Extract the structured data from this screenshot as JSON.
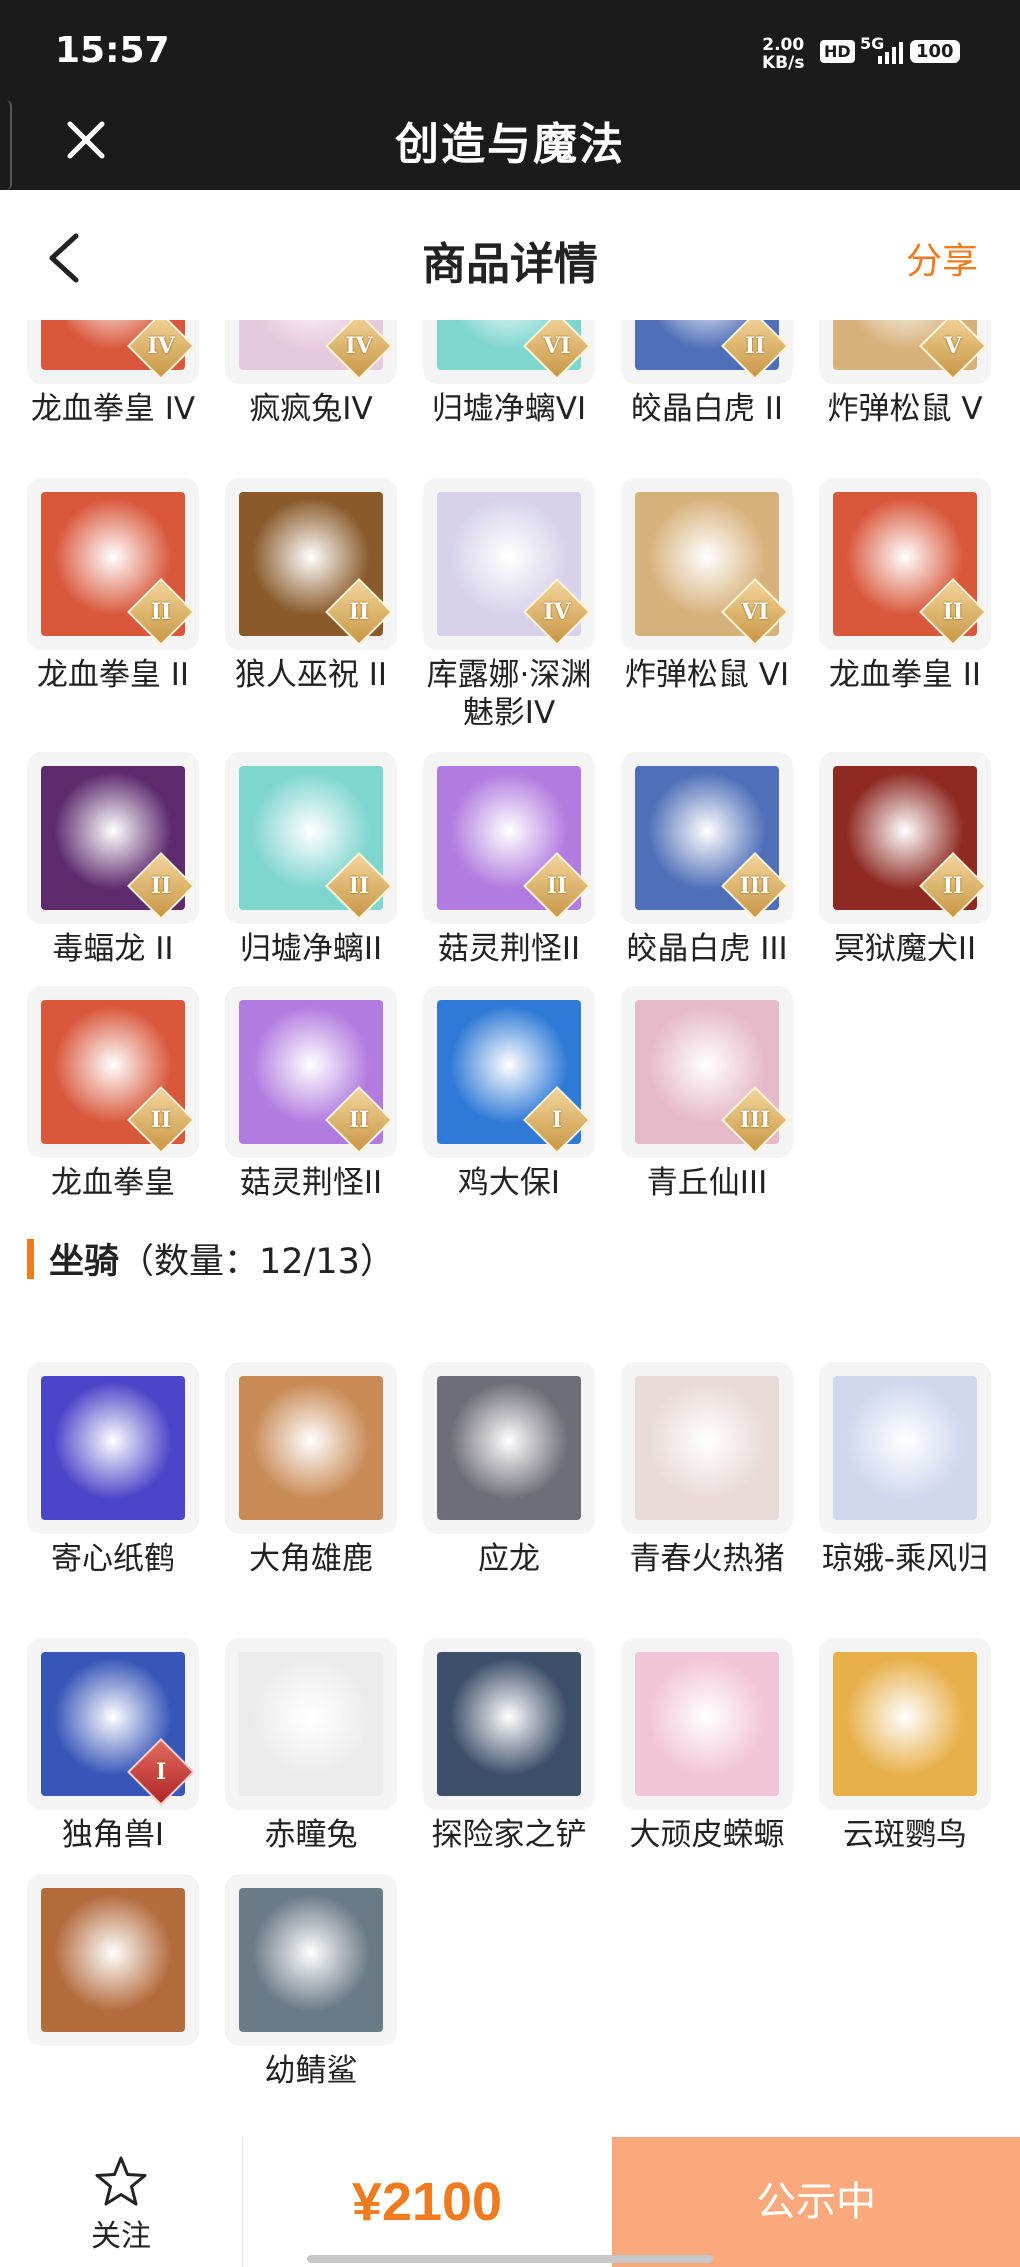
{
  "status_bar": {
    "time": "15:57",
    "net_speed": "2.00",
    "net_unit": "KB/s",
    "hd": "HD",
    "signal": "5G",
    "battery": "100"
  },
  "app": {
    "title": "创造与魔法"
  },
  "page": {
    "title": "商品详情",
    "share": "分享"
  },
  "pets": [
    {
      "name": "龙血拳皇 IV",
      "badge": "IV",
      "icon": "dragon-boxer-icon",
      "color": "#d9573a"
    },
    {
      "name": "疯疯兔IV",
      "badge": "IV",
      "icon": "crazy-rabbit-icon",
      "color": "#e7c9dd"
    },
    {
      "name": "归墟净螭VI",
      "badge": "VI",
      "icon": "sea-dragon-icon",
      "color": "#7fd6cf"
    },
    {
      "name": "皎晶白虎 II",
      "badge": "II",
      "icon": "white-tiger-icon",
      "color": "#4f6fb8"
    },
    {
      "name": "炸弹松鼠 V",
      "badge": "V",
      "icon": "bomb-squirrel-icon",
      "color": "#d8b27c"
    },
    {
      "name": "龙血拳皇 II",
      "badge": "II",
      "icon": "dragon-boxer-icon",
      "color": "#d9573a"
    },
    {
      "name": "狼人巫祝 II",
      "badge": "II",
      "icon": "werewolf-shaman-icon",
      "color": "#8a5a2a"
    },
    {
      "name": "库露娜·深渊魅影IV",
      "badge": "IV",
      "icon": "kuluna-icon",
      "color": "#d7d2ea"
    },
    {
      "name": "炸弹松鼠 VI",
      "badge": "VI",
      "icon": "bomb-squirrel-icon",
      "color": "#d8b27c"
    },
    {
      "name": "龙血拳皇 II",
      "badge": "II",
      "icon": "dragon-boxer-icon",
      "color": "#d9573a"
    },
    {
      "name": "毒蝠龙 II",
      "badge": "II",
      "icon": "poison-bat-dragon-icon",
      "color": "#5d2a6e"
    },
    {
      "name": "归墟净螭II",
      "badge": "II",
      "icon": "sea-dragon-icon",
      "color": "#7fd6cf"
    },
    {
      "name": "菇灵荆怪II",
      "badge": "II",
      "icon": "mushroom-sprite-icon",
      "color": "#b27be0"
    },
    {
      "name": "皎晶白虎 III",
      "badge": "III",
      "icon": "white-tiger-icon",
      "color": "#4f6fb8"
    },
    {
      "name": "冥狱魔犬II",
      "badge": "II",
      "icon": "hell-hound-icon",
      "color": "#8e2a22"
    },
    {
      "name": "龙血拳皇",
      "badge": "II",
      "icon": "dragon-boxer-icon",
      "color": "#d9573a"
    },
    {
      "name": "菇灵荆怪II",
      "badge": "II",
      "icon": "mushroom-sprite-icon",
      "color": "#b27be0"
    },
    {
      "name": "鸡大保I",
      "badge": "I",
      "icon": "chicken-boss-icon",
      "color": "#2f7ad6"
    },
    {
      "name": "青丘仙III",
      "badge": "III",
      "icon": "fox-fairy-icon",
      "color": "#e6b9c8"
    }
  ],
  "mounts_section": {
    "title": "坐骑",
    "count": "（数量：12/13）"
  },
  "mounts": [
    {
      "name": "寄心纸鹤",
      "badge": "",
      "icon": "paper-crane-icon",
      "color": "#4b45c8"
    },
    {
      "name": "大角雄鹿",
      "badge": "",
      "icon": "stag-icon",
      "color": "#c98a55"
    },
    {
      "name": "应龙",
      "badge": "",
      "icon": "ying-dragon-icon",
      "color": "#6e6e78"
    },
    {
      "name": "青春火热猪",
      "badge": "",
      "icon": "pig-icon",
      "color": "#e9dad8"
    },
    {
      "name": "琼娥-乘风归",
      "badge": "",
      "icon": "qiong-e-icon",
      "color": "#cfd8ef"
    },
    {
      "name": "独角兽I",
      "badge": "I",
      "icon": "unicorn-icon",
      "color": "#3856b8"
    },
    {
      "name": "赤瞳兔",
      "badge": "",
      "icon": "white-rabbit-icon",
      "color": "#ececec"
    },
    {
      "name": "探险家之铲",
      "badge": "",
      "icon": "shovel-icon",
      "color": "#3d4f6a"
    },
    {
      "name": "大顽皮蝾螈",
      "badge": "",
      "icon": "axolotl-icon",
      "color": "#f2c4d8"
    },
    {
      "name": "云斑鹦鸟",
      "badge": "",
      "icon": "parrot-icon",
      "color": "#e8b04a"
    },
    {
      "name": "",
      "badge": "",
      "icon": "capybara-icon",
      "color": "#b36b3c"
    },
    {
      "name": "幼鲭鲨",
      "badge": "",
      "icon": "shark-icon",
      "color": "#6a7a86"
    }
  ],
  "bottom": {
    "follow": "关注",
    "price": "¥2100",
    "status": "公示中"
  }
}
